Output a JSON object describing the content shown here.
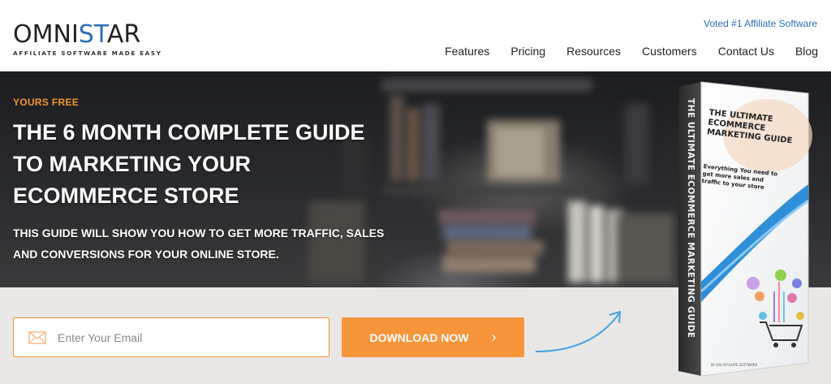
{
  "brand": {
    "name_part1": "OMNI",
    "name_part2": "ST",
    "name_part3": "AR",
    "tagline": "AFFILIATE SOFTWARE MADE EASY",
    "voted": "Voted #1 Affiliate Software",
    "accent": "#2b6fb6"
  },
  "nav": {
    "items": [
      "Features",
      "Pricing",
      "Resources",
      "Customers",
      "Contact Us",
      "Blog"
    ]
  },
  "hero": {
    "eyebrow": "YOURS FREE",
    "title": "THE 6 MONTH COMPLETE GUIDE TO MARKETING YOUR ECOMMERCE STORE",
    "subtitle": "THIS GUIDE WILL SHOW YOU HOW TO GET MORE TRAFFIC, SALES AND CONVERSIONS FOR YOUR ONLINE STORE."
  },
  "form": {
    "email_placeholder": "Enter Your Email",
    "email_value": "",
    "button_label": "DOWNLOAD NOW",
    "button_icon": "chevron-right-icon",
    "accent": "#f6953a"
  },
  "book": {
    "spine_text": "THE ULTIMATE ECOMMERCE MARKETING GUIDE",
    "cover_title_1": "THE ULTIMATE",
    "cover_title_2": "ECOMMERCE",
    "cover_title_3": "MARKETING GUIDE",
    "cover_sub_1": "Everything You need to",
    "cover_sub_2": "get more sales and",
    "cover_sub_3": "traffic to your store",
    "footer_text": "BY OSI AFFILIATE SOFTWARE"
  }
}
